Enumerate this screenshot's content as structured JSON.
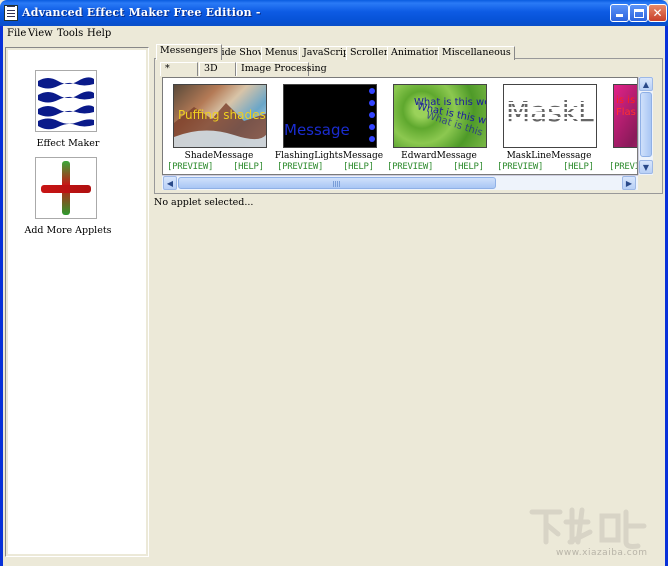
{
  "window": {
    "title": "Advanced Effect Maker Free Edition -"
  },
  "menu": {
    "items": [
      "File",
      "View",
      "Tools",
      "Help"
    ]
  },
  "sidebar": {
    "items": [
      {
        "label": "Effect Maker",
        "icon": "waves-icon"
      },
      {
        "label": "Add More Applets",
        "icon": "plus-icon"
      }
    ]
  },
  "tabs": {
    "main": [
      "Messengers",
      "Slide Shows",
      "Menus",
      "JavaScript",
      "Scrollers",
      "Animations",
      "Miscellaneous"
    ],
    "active": "Messengers",
    "sub": [
      "*",
      "3D",
      "Image Processing"
    ],
    "sub_active": "*"
  },
  "applets": [
    {
      "name": "ShadeMessage",
      "preview": "[PREVIEW]",
      "help": "[HELP]",
      "thumb_text": "Puffing shades"
    },
    {
      "name": "FlashingLightsMessage",
      "preview": "[PREVIEW]",
      "help": "[HELP]",
      "thumb_text": "Message"
    },
    {
      "name": "EdwardMessage",
      "preview": "[PREVIEW]",
      "help": "[HELP]",
      "thumb_text": "What is this wei"
    },
    {
      "name": "MaskLineMessage",
      "preview": "[PREVIEW]",
      "help": "[HELP]",
      "thumb_text": "MaskL"
    },
    {
      "name": "",
      "preview": "[PREVI",
      "help": "",
      "thumb_text": "is is"
    }
  ],
  "status": {
    "text": "No applet selected..."
  },
  "watermark": {
    "text": "www.xiazaiba.com"
  },
  "colors": {
    "titlebar": "#0a5ce0",
    "link_green": "#2e8b2e",
    "face": "#ece9d8"
  }
}
